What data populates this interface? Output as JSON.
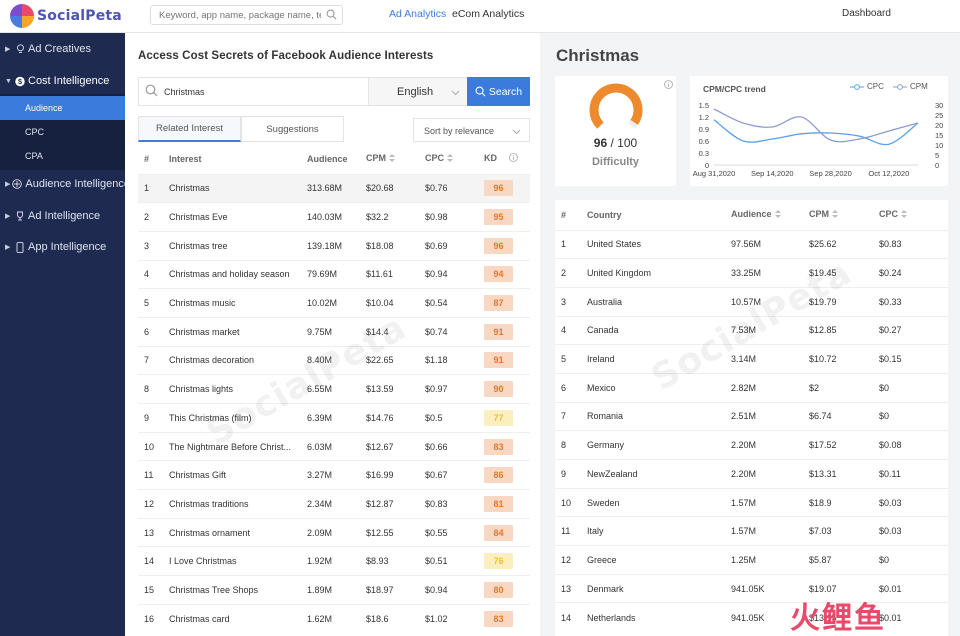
{
  "app": {
    "brand_name": "SocialPeta",
    "brand_colors": {
      "primary": "#3a7bdc",
      "kd_high": "#e6762e",
      "kd_mid": "#e8c23a"
    }
  },
  "topbar": {
    "search_placeholder": "Keyword, app name, package name, text o",
    "nav": {
      "ad_analytics": "Ad Analytics",
      "ecom_analytics": "eCom Analytics",
      "dashboard": "Dashboard"
    }
  },
  "sidebar": {
    "items": [
      {
        "label": "Ad Creatives",
        "icon": "bulb-icon"
      },
      {
        "label": "Cost Intelligence",
        "icon": "dollar-icon"
      },
      {
        "label": "Audience Intelligence",
        "icon": "target-icon"
      },
      {
        "label": "Ad Intelligence",
        "icon": "trophy-icon"
      },
      {
        "label": "App Intelligence",
        "icon": "phone-icon"
      }
    ],
    "subitems": [
      {
        "label": "Audience",
        "active": true
      },
      {
        "label": "CPC",
        "active": false
      },
      {
        "label": "CPA",
        "active": false
      }
    ]
  },
  "left": {
    "title": "Access Cost Secrets of Facebook Audience Interests",
    "search_query": "Christmas",
    "language": "English",
    "search_button": "Search",
    "tabs": [
      "Related Interest",
      "Suggestions"
    ],
    "sort": "Sort by relevance",
    "columns": [
      "#",
      "Interest",
      "Audience",
      "CPM",
      "CPC",
      "KD"
    ],
    "rows": [
      [
        "1",
        "Christmas",
        "313.68M",
        "$20.68",
        "$0.76",
        "96"
      ],
      [
        "2",
        "Christmas Eve",
        "140.03M",
        "$32.2",
        "$0.98",
        "95"
      ],
      [
        "3",
        "Christmas tree",
        "139.18M",
        "$18.08",
        "$0.69",
        "96"
      ],
      [
        "4",
        "Christmas and holiday season",
        "79.69M",
        "$11.61",
        "$0.94",
        "94"
      ],
      [
        "5",
        "Christmas music",
        "10.02M",
        "$10.04",
        "$0.54",
        "87"
      ],
      [
        "6",
        "Christmas market",
        "9.75M",
        "$14.4",
        "$0.74",
        "91"
      ],
      [
        "7",
        "Christmas decoration",
        "8.40M",
        "$22.65",
        "$1.18",
        "91"
      ],
      [
        "8",
        "Christmas lights",
        "6.55M",
        "$13.59",
        "$0.97",
        "90"
      ],
      [
        "9",
        "This Christmas (film)",
        "6.39M",
        "$14.76",
        "$0.5",
        "77"
      ],
      [
        "10",
        "The Nightmare Before Christ...",
        "6.03M",
        "$12.67",
        "$0.66",
        "83"
      ],
      [
        "11",
        "Christmas Gift",
        "3.27M",
        "$16.99",
        "$0.67",
        "86"
      ],
      [
        "12",
        "Christmas traditions",
        "2.34M",
        "$12.87",
        "$0.83",
        "81"
      ],
      [
        "13",
        "Christmas ornament",
        "2.09M",
        "$12.55",
        "$0.55",
        "84"
      ],
      [
        "14",
        "I Love Christmas",
        "1.92M",
        "$8.93",
        "$0.51",
        "76"
      ],
      [
        "15",
        "Christmas Tree Shops",
        "1.89M",
        "$18.97",
        "$0.94",
        "80"
      ],
      [
        "16",
        "Christmas card",
        "1.62M",
        "$18.6",
        "$1.02",
        "83"
      ]
    ]
  },
  "right": {
    "title": "Christmas",
    "difficulty": {
      "score": "96",
      "max": "/ 100",
      "label": "Difficulty",
      "value_fraction": 0.96
    },
    "trend": {
      "title": "CPM/CPC trend",
      "legend_cpc": "CPC",
      "legend_cpm": "CPM"
    },
    "chart_data": {
      "type": "line",
      "title": "CPM/CPC trend",
      "x_ticks": [
        "Aug 31,2020",
        "Sep 14,2020",
        "Sep 28,2020",
        "Oct 12,2020"
      ],
      "y_left_ticks": [
        "0",
        "0.3",
        "0.6",
        "0.9",
        "1.2",
        "1.5"
      ],
      "y_right_ticks": [
        "0",
        "5",
        "10",
        "15",
        "20",
        "25",
        "30"
      ],
      "ylim_left": [
        0,
        1.5
      ],
      "ylim_right": [
        0,
        30
      ],
      "x_days": [
        0,
        7,
        14,
        21,
        28,
        35,
        42,
        49
      ],
      "series": [
        {
          "name": "CPC",
          "axis": "left",
          "values": [
            1.13,
            0.6,
            0.65,
            0.78,
            0.8,
            0.72,
            0.52,
            1.05
          ]
        },
        {
          "name": "CPM",
          "axis": "right",
          "values": [
            28,
            21,
            19,
            24,
            12.5,
            13,
            17,
            21
          ]
        }
      ],
      "legend": "top-right",
      "grid": false
    },
    "columns": [
      "#",
      "Country",
      "Audience",
      "CPM",
      "CPC"
    ],
    "rows": [
      [
        "1",
        "United States",
        "97.56M",
        "$25.62",
        "$0.83"
      ],
      [
        "2",
        "United Kingdom",
        "33.25M",
        "$19.45",
        "$0.24"
      ],
      [
        "3",
        "Australia",
        "10.57M",
        "$19.79",
        "$0.33"
      ],
      [
        "4",
        "Canada",
        "7.53M",
        "$12.85",
        "$0.27"
      ],
      [
        "5",
        "Ireland",
        "3.14M",
        "$10.72",
        "$0.15"
      ],
      [
        "6",
        "Mexico",
        "2.82M",
        "$2",
        "$0"
      ],
      [
        "7",
        "Romania",
        "2.51M",
        "$6.74",
        "$0"
      ],
      [
        "8",
        "Germany",
        "2.20M",
        "$17.52",
        "$0.08"
      ],
      [
        "9",
        "NewZealand",
        "2.20M",
        "$13.31",
        "$0.11"
      ],
      [
        "10",
        "Sweden",
        "1.57M",
        "$18.9",
        "$0.03"
      ],
      [
        "11",
        "Italy",
        "1.57M",
        "$7.03",
        "$0.03"
      ],
      [
        "12",
        "Greece",
        "1.25M",
        "$5.87",
        "$0"
      ],
      [
        "13",
        "Denmark",
        "941.05K",
        "$19.07",
        "$0.01"
      ],
      [
        "14",
        "Netherlands",
        "941.05K",
        "$13.15",
        "$0.01"
      ]
    ]
  },
  "watermark": {
    "text": "SocialPeta",
    "corner_chars": "火鲤鱼"
  }
}
